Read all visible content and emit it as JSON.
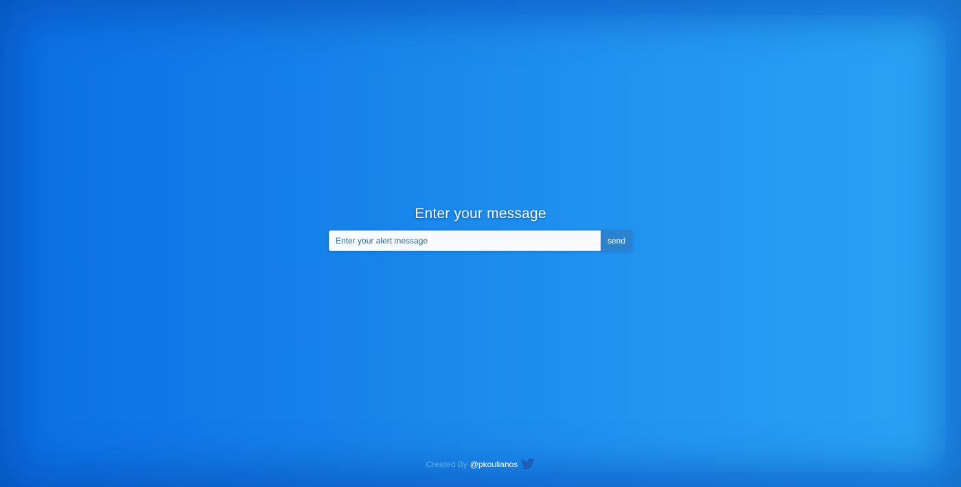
{
  "page": {
    "heading": "Enter your message"
  },
  "form": {
    "input_value": "",
    "input_placeholder": "Enter your alert message",
    "send_label": "send"
  },
  "footer": {
    "credit_text": "Created By",
    "handle": "@pkoulianos",
    "icon": "twitter-bird-icon"
  },
  "colors": {
    "background_left": "#0a6fe3",
    "background_right": "#2aa4f6",
    "send_button": "#2c82cf",
    "twitter_icon": "#1d5fb8"
  }
}
